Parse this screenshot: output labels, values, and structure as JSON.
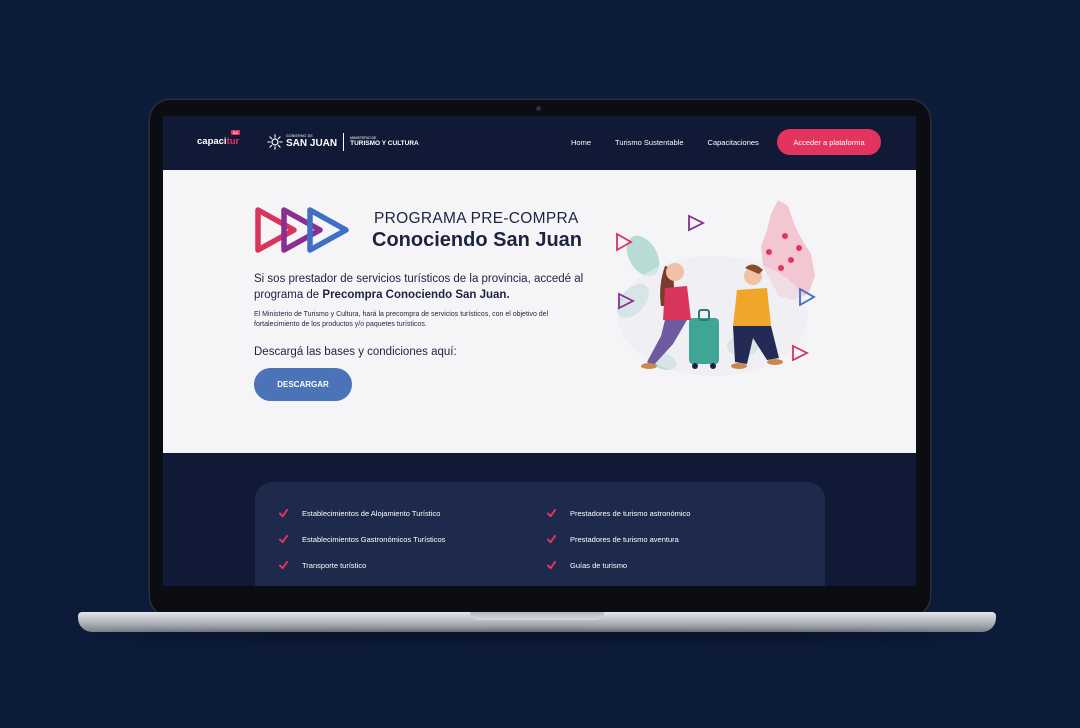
{
  "brand": {
    "name_a": "capaci",
    "name_b": "tur",
    "tag": "SJ"
  },
  "govt": {
    "small": "GOBIERNO DE",
    "big": "SAN JUAN",
    "ministry_small": "MINISTERIO DE",
    "ministry_big": "TURISMO Y CULTURA"
  },
  "nav": {
    "links": [
      "Home",
      "Turismo Sustentable",
      "Capacitaciones"
    ],
    "cta": "Acceder a plataforma"
  },
  "hero": {
    "kicker": "PROGRAMA PRE-COMPRA",
    "title": "Conociendo San Juan",
    "lead_part1": "Si sos prestador de servicios turísticos de la provincia, accedé al programa de ",
    "lead_bold": "Precompra Conociendo San Juan.",
    "description": "El Ministerio de Turismo y Cultura, hará la precompra de servicios turísticos, con el objetivo del fortalecimiento de los productos y/o paquetes turísticos.",
    "download_label": "Descargá las bases y condiciones aquí:",
    "download_button": "DESCARGAR"
  },
  "features": {
    "left": [
      "Establecimientos de Alojamiento Turístico",
      "Establecimientos Gastronómicos Turísticos",
      "Transporte turístico"
    ],
    "right": [
      "Prestadores de turismo astronómico",
      "Prestadores de turismo aventura",
      "Guías de turismo"
    ]
  },
  "colors": {
    "background": "#0d1b3a",
    "navbar": "#101a36",
    "accent": "#e2345c",
    "button_blue": "#4a73b8",
    "card": "#1d2a4c"
  }
}
